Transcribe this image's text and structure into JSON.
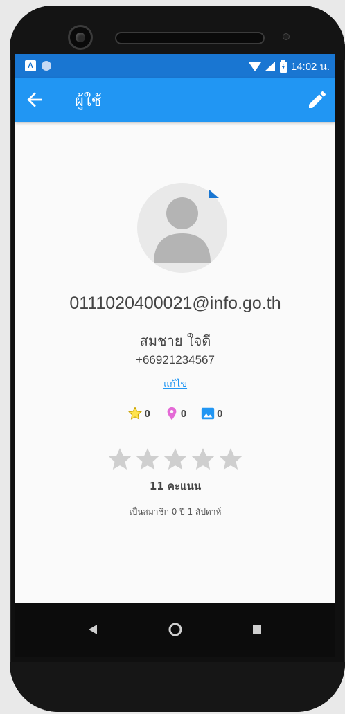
{
  "status_bar": {
    "time": "14:02 น.",
    "icons": [
      "a-notification-icon",
      "dot-notification-icon",
      "wifi-icon",
      "signal-icon",
      "battery-icon"
    ]
  },
  "app_bar": {
    "title": "ผู้ใช้",
    "back_icon": "arrow-back-icon",
    "edit_icon": "pencil-icon"
  },
  "profile": {
    "email": "0111020400021@info.go.th",
    "full_name": "สมชาย ใจดี",
    "phone": "+66921234567",
    "edit_link": "แก้ไข"
  },
  "counts": [
    {
      "icon": "star-outline-icon",
      "value": "0",
      "color": "#f5c800"
    },
    {
      "icon": "location-pin-icon",
      "value": "0",
      "color": "#e46ad6"
    },
    {
      "icon": "image-icon",
      "value": "0",
      "color": "#2196f3"
    }
  ],
  "rating": {
    "stars_filled": 0,
    "stars_total": 5,
    "score_text": "11 คะแนน",
    "membership_text": "เป็นสมาชิก 0 ปี 1 สัปดาห์"
  },
  "colors": {
    "status_bar": "#1976d2",
    "app_bar": "#2196f3",
    "star_empty": "#cfcfcf"
  }
}
